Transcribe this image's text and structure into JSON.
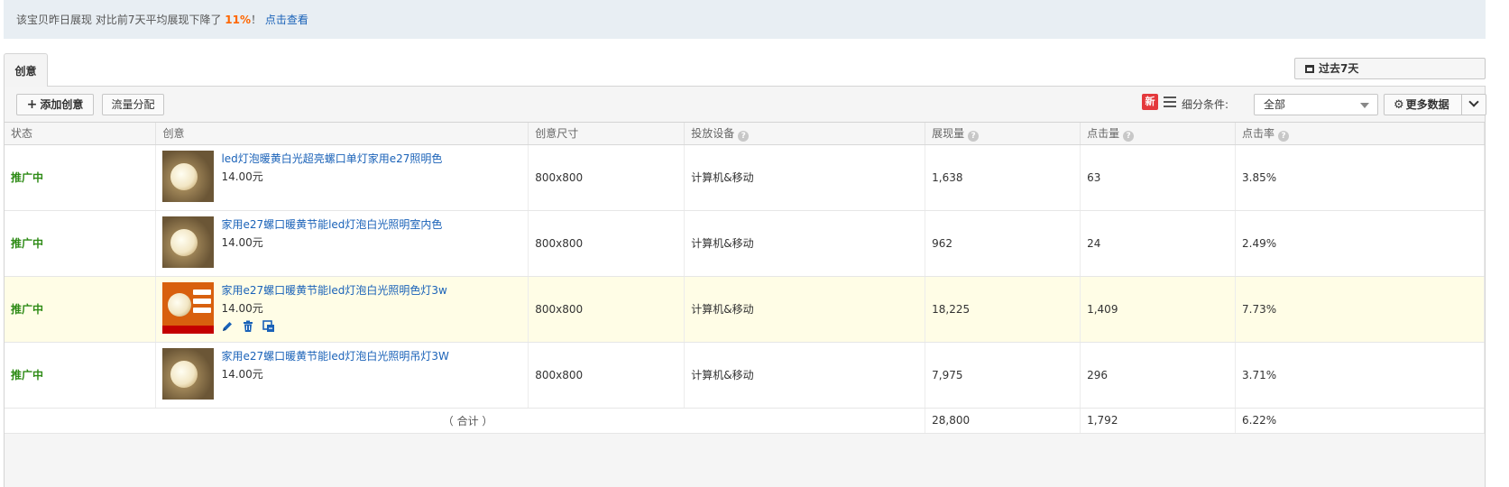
{
  "notice": {
    "prefix": "该宝贝昨日展现 对比前7天平均展现下降了 ",
    "percent": "11%",
    "suffix": "！",
    "link": "点击查看"
  },
  "tab": {
    "label": "创意"
  },
  "range": {
    "label": "过去7天",
    "icon": "calendar-icon"
  },
  "toolbar": {
    "add_label": "添加创意",
    "flow_label": "流量分配",
    "new_badge": "新",
    "filter_label": "细分条件:",
    "filter_value": "全部",
    "more_label": "更多数据"
  },
  "table": {
    "headers": {
      "status": "状态",
      "creative": "创意",
      "size": "创意尺寸",
      "device": "投放设备",
      "impressions": "展现量",
      "clicks": "点击量",
      "ctr": "点击率"
    },
    "help_glyph": "?",
    "rows": [
      {
        "status": "推广中",
        "title": "led灯泡暖黄白光超亮螺口单灯家用e27照明色",
        "price": "14.00元",
        "size": "800x800",
        "device": "计算机&移动",
        "impressions": "1,638",
        "clicks": "63",
        "ctr": "3.85%"
      },
      {
        "status": "推广中",
        "title": "家用e27螺口暖黄节能led灯泡白光照明室内色",
        "price": "14.00元",
        "size": "800x800",
        "device": "计算机&移动",
        "impressions": "962",
        "clicks": "24",
        "ctr": "2.49%"
      },
      {
        "status": "推广中",
        "title": "家用e27螺口暖黄节能led灯泡白光照明色灯3w",
        "price": "14.00元",
        "size": "800x800",
        "device": "计算机&移动",
        "impressions": "18,225",
        "clicks": "1,409",
        "ctr": "7.73%"
      },
      {
        "status": "推广中",
        "title": "家用e27螺口暖黄节能led灯泡白光照明吊灯3W",
        "price": "14.00元",
        "size": "800x800",
        "device": "计算机&移动",
        "impressions": "7,975",
        "clicks": "296",
        "ctr": "3.71%"
      }
    ],
    "total": {
      "label": "（ 合计 ）",
      "impressions": "28,800",
      "clicks": "1,792",
      "ctr": "6.22%"
    }
  },
  "colors": {
    "status_green": "#2e8b16",
    "link_blue": "#1a62b8",
    "alert_orange": "#ff6600",
    "highlight_row": "#fffde6"
  }
}
